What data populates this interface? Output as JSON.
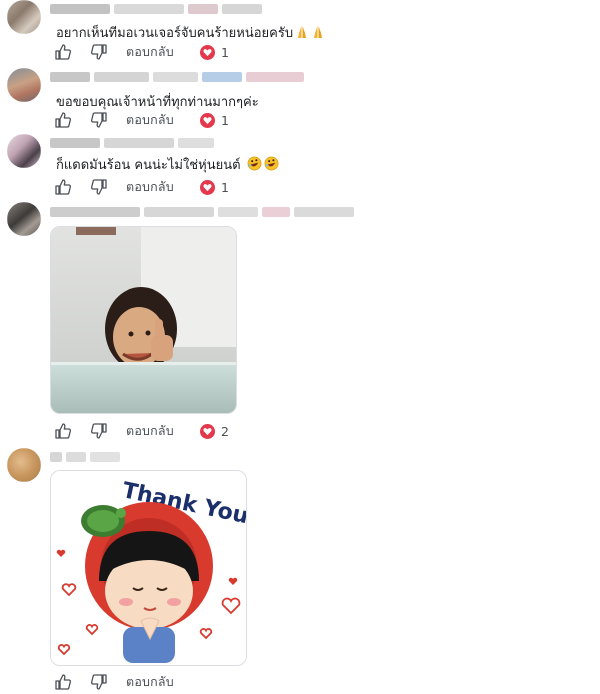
{
  "comments": [
    {
      "text": "อยากเห็นทีมอเวนเจอร์จับคนร้ายหน่อยครับ",
      "emoji": [
        "folded-hands",
        "folded-hands"
      ],
      "reply_label": "ตอบกลับ",
      "reactions": "1"
    },
    {
      "text": "ขอขอบคุณเจ้าหน้าที่ทุกท่านมากๆค่ะ",
      "reply_label": "ตอบกลับ",
      "reactions": "1"
    },
    {
      "text": "ก็แดดมันร้อน คนน่ะไม่ใช่หุ่นยนต์",
      "emoji": [
        "rolling-laughing",
        "rolling-laughing"
      ],
      "reply_label": "ตอบกลับ",
      "reactions": "1"
    },
    {
      "media": "gif-child-thumbs-up",
      "reply_label": "ตอบกลับ",
      "reactions": "2"
    },
    {
      "media": "sticker-thank-you-girl",
      "sticker_text": "Thank You",
      "reply_label": "ตอบกลับ"
    }
  ],
  "colors": {
    "heart": "#e4384d",
    "sticker_blue": "#1b2f6b",
    "sticker_red": "#d83a2e"
  }
}
